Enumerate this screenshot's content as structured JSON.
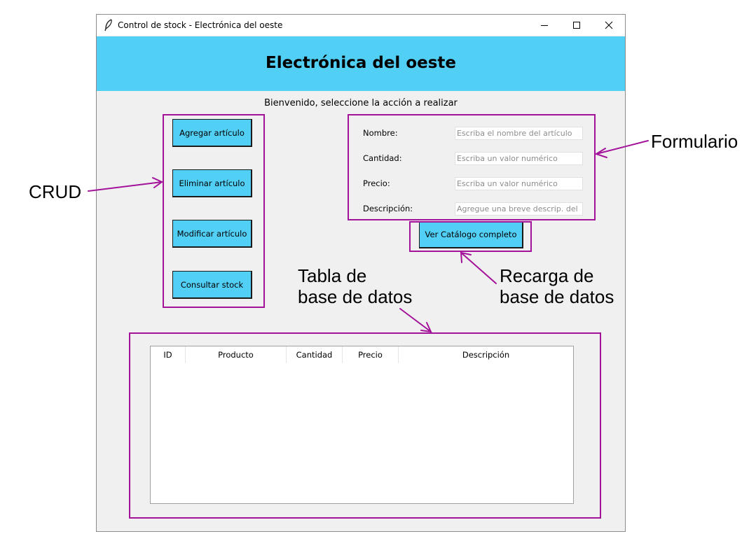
{
  "window": {
    "title": "Control de stock - Electrónica del oeste",
    "controls": [
      "minimize-icon",
      "maximize-icon",
      "close-icon"
    ]
  },
  "header": {
    "title": "Electrónica del oeste",
    "background": "#52cff5"
  },
  "welcome": "Bienvenido, seleccione la acción a realizar",
  "crud": {
    "add": "Agregar artículo",
    "delete": "Eliminar artículo",
    "modify": "Modificar artículo",
    "stock": "Consultar stock"
  },
  "form": {
    "name": {
      "label": "Nombre:",
      "placeholder": "Escriba el nombre del artículo"
    },
    "quantity": {
      "label": "Cantidad:",
      "placeholder": "Escriba un valor numérico"
    },
    "price": {
      "label": "Precio:",
      "placeholder": "Escriba un valor numérico"
    },
    "description": {
      "label": "Descripción:",
      "placeholder": "Agregue una breve descrip. del art"
    }
  },
  "catalog_button": "Ver Catálogo completo",
  "table": {
    "columns": [
      "ID",
      "Producto",
      "Cantidad",
      "Precio",
      "Descripción"
    ],
    "rows": []
  },
  "annotations": {
    "crud": "CRUD",
    "form": "Formulario",
    "table_line1": "Tabla de",
    "table_line2": "base de datos",
    "reload_line1": "Recarga de",
    "reload_line2": "base de datos",
    "color": "#a3139a"
  }
}
